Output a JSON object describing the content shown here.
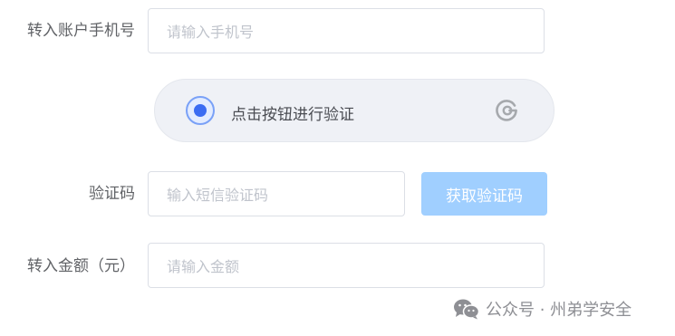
{
  "form": {
    "phone": {
      "label": "转入账户手机号",
      "placeholder": "请输入手机号"
    },
    "captcha": {
      "label": "点击按钮进行验证",
      "icon": "refresh-icon"
    },
    "sms_code": {
      "label": "验证码",
      "placeholder": "输入短信验证码",
      "button_label": "获取验证码"
    },
    "amount": {
      "label": "转入金额（元）",
      "placeholder": "请输入金额"
    }
  },
  "watermark": {
    "text": "公众号 · 州弟学安全",
    "icon": "wechat-icon"
  },
  "colors": {
    "primary": "#409eff",
    "button_disabled": "#a0cfff",
    "captcha_dot": "#3b6cf2",
    "border": "#dcdfe6",
    "placeholder": "#c0c4cc",
    "label": "#606266"
  }
}
